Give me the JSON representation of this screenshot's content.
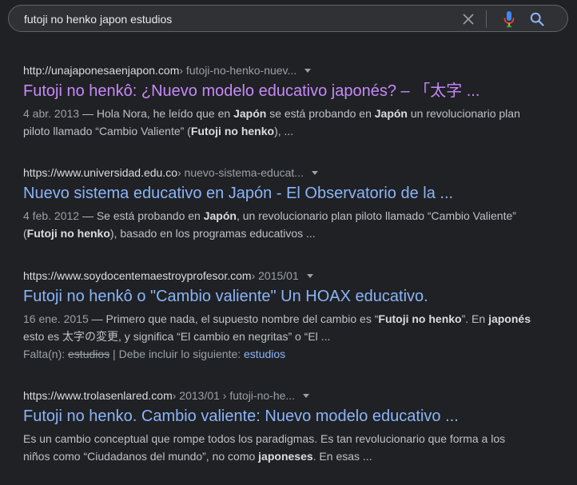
{
  "search": {
    "query": "futoji no henko japon estudios"
  },
  "icons": {
    "clear": "close-icon",
    "mic": "microphone-icon",
    "search": "magnifier-icon"
  },
  "colors": {
    "background": "#202124",
    "link": "#8ab4f8",
    "visited_link": "#c58af9",
    "snippet": "#bdc1c6"
  },
  "results": [
    {
      "domain": "http://unajaponesaenjapon.com",
      "path": " › futoji-no-henko-nuev...",
      "title": "Futoji no henkô: ¿Nuevo modelo educativo japonés? – 「太字 ...",
      "date": "4 abr. 2013",
      "snippet": [
        {
          "t": " — Hola Nora, he leído que en "
        },
        {
          "t": "Japón",
          "b": true
        },
        {
          "t": " se está probando en "
        },
        {
          "t": "Japón",
          "b": true
        },
        {
          "t": " un revolucionario plan piloto llamado “Cambio Valiente” ("
        },
        {
          "t": "Futoji no henko",
          "b": true
        },
        {
          "t": "), ..."
        }
      ]
    },
    {
      "domain": "https://www.universidad.edu.co",
      "path": " › nuevo-sistema-educat...",
      "title": "Nuevo sistema educativo en Japón - El Observatorio de la ...",
      "date": "4 feb. 2012",
      "snippet": [
        {
          "t": " — Se está probando en "
        },
        {
          "t": "Japón",
          "b": true
        },
        {
          "t": ", un revolucionario plan piloto llamado “Cambio Valiente” ("
        },
        {
          "t": "Futoji no henko",
          "b": true
        },
        {
          "t": "), basado en los programas educativos ..."
        }
      ]
    },
    {
      "domain": "https://www.soydocentemaestroyprofesor.com",
      "path": " › 2015/01",
      "title": "Futoji no henkô o \"Cambio valiente\" Un HOAX educativo.",
      "date": "16 ene. 2015",
      "snippet": [
        {
          "t": " — Primero que nada, el supuesto nombre del cambio es “"
        },
        {
          "t": "Futoji no henko",
          "b": true
        },
        {
          "t": "”. En "
        },
        {
          "t": "japonés",
          "b": true
        },
        {
          "t": " esto es 太字の変更, y significa “El cambio en negritas” o “El ..."
        }
      ],
      "missing": {
        "label": "Falta(n): ",
        "term": "estudios",
        "separator": " | Debe incluir lo siguiente: ",
        "link": "estudios"
      }
    },
    {
      "domain": "https://www.trolasenlared.com",
      "path": " › 2013/01 › futoji-no-he...",
      "title": "Futoji no henko. Cambio valiente: Nuevo modelo educativo ...",
      "date": "",
      "snippet": [
        {
          "t": "Es un cambio conceptual que rompe todos los paradigmas. Es tan revolucionario que forma a los niños como “Ciudadanos del mundo”, no como "
        },
        {
          "t": "japoneses",
          "b": true
        },
        {
          "t": ". En esas ..."
        }
      ]
    }
  ]
}
